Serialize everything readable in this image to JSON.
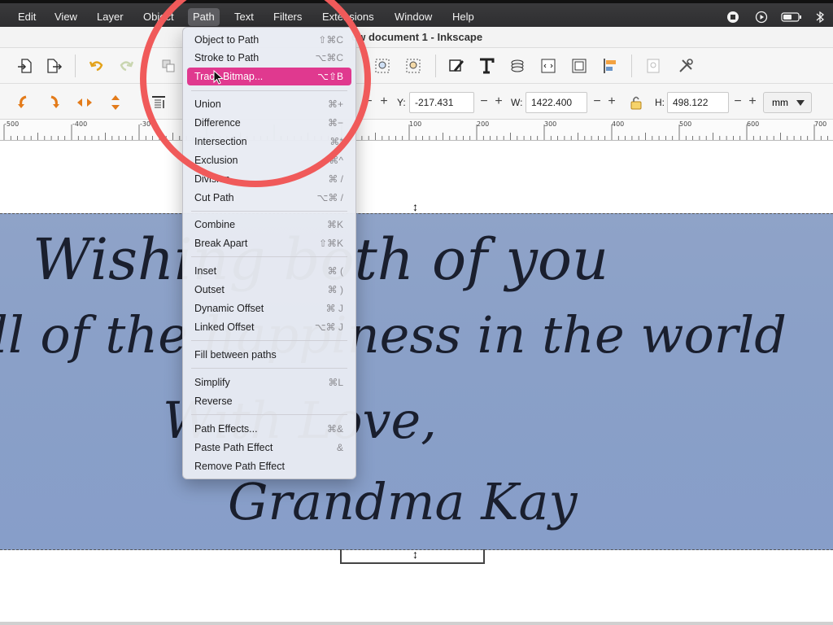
{
  "menubar": {
    "items": [
      "Edit",
      "View",
      "Layer",
      "Object",
      "Path",
      "Text",
      "Filters",
      "Extensions",
      "Window",
      "Help"
    ],
    "active": "Path"
  },
  "window": {
    "title": "ew document 1 - Inkscape"
  },
  "controls": {
    "y_label": "Y:",
    "y_value": "-217.431",
    "w_label": "W:",
    "w_value": "1422.400",
    "h_label": "H:",
    "h_value": "498.122",
    "unit": "mm",
    "spin_minus": "−",
    "spin_plus": "+"
  },
  "ruler": {
    "labels": [
      "-500",
      "-400",
      "-300",
      "100",
      "200",
      "300",
      "400",
      "500",
      "600",
      "700"
    ]
  },
  "path_menu": {
    "items": [
      {
        "label": "Object to Path",
        "shortcut": "⇧⌘C"
      },
      {
        "label": "Stroke to Path",
        "shortcut": "⌥⌘C"
      },
      {
        "label": "Trace Bitmap...",
        "shortcut": "⌥⇧B",
        "highlighted": true
      },
      {
        "label": "Union",
        "shortcut": "⌘+"
      },
      {
        "label": "Difference",
        "shortcut": "⌘−"
      },
      {
        "label": "Intersection",
        "shortcut": "⌘*"
      },
      {
        "label": "Exclusion",
        "shortcut": "⌘^"
      },
      {
        "label": "Division",
        "shortcut": "⌘ /"
      },
      {
        "label": "Cut Path",
        "shortcut": "⌥⌘ /"
      },
      {
        "label": "Combine",
        "shortcut": "⌘K"
      },
      {
        "label": "Break Apart",
        "shortcut": "⇧⌘K"
      },
      {
        "label": "Inset",
        "shortcut": "⌘ ("
      },
      {
        "label": "Outset",
        "shortcut": "⌘ )"
      },
      {
        "label": "Dynamic Offset",
        "shortcut": "⌘ J"
      },
      {
        "label": "Linked Offset",
        "shortcut": "⌥⌘ J"
      },
      {
        "label": "Fill between paths",
        "shortcut": ""
      },
      {
        "label": "Simplify",
        "shortcut": "⌘L"
      },
      {
        "label": "Reverse",
        "shortcut": ""
      },
      {
        "label": "Path Effects...",
        "shortcut": "⌘&"
      },
      {
        "label": "Paste Path Effect",
        "shortcut": "&"
      },
      {
        "label": "Remove Path Effect",
        "shortcut": ""
      }
    ]
  },
  "bitmap": {
    "lines": [
      "Wishing both of you",
      "ll of the happiness in the world",
      "With Love,",
      "Grandma Kay"
    ]
  },
  "colors": {
    "highlight": "#e0398f",
    "annotation_circle": "#f05a5a",
    "bitmap_bg": "#8aa0c8"
  }
}
